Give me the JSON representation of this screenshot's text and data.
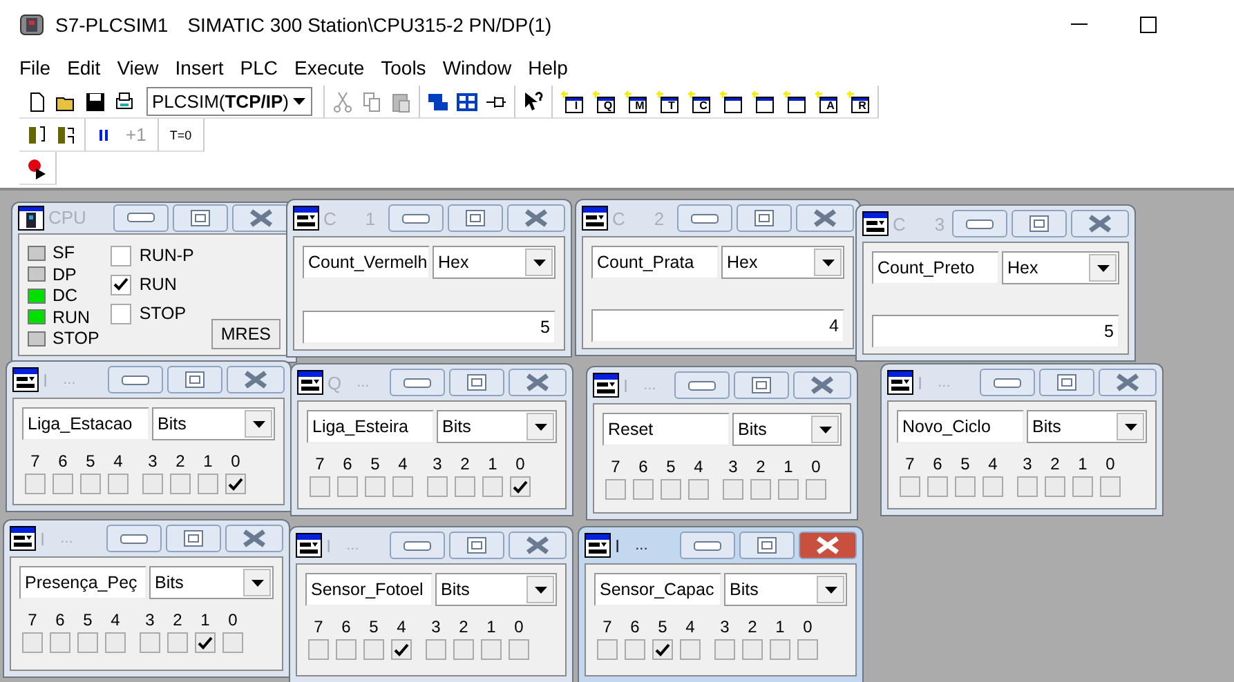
{
  "window": {
    "app": "S7-PLCSIM1",
    "title": "SIMATIC 300 Station\\CPU315-2 PN/DP(1)"
  },
  "menu": [
    "File",
    "Edit",
    "View",
    "Insert",
    "PLC",
    "Execute",
    "Tools",
    "Window",
    "Help"
  ],
  "toolbar": {
    "connection": "PLCSIM(**TCP/IP**)",
    "insert_buttons": [
      {
        "kind": "letter",
        "glyph": "I"
      },
      {
        "kind": "letter",
        "glyph": "Q"
      },
      {
        "kind": "letter",
        "glyph": "M"
      },
      {
        "kind": "letter",
        "glyph": "T"
      },
      {
        "kind": "letter",
        "glyph": "C"
      },
      {
        "kind": "plain"
      },
      {
        "kind": "plain"
      },
      {
        "kind": "plain"
      },
      {
        "kind": "letter",
        "glyph": "A"
      },
      {
        "kind": "letter",
        "glyph": "R"
      }
    ],
    "step": "+1",
    "reset_timers": "T=0"
  },
  "windows": [
    {
      "kind": "cpu",
      "title": "CPU",
      "active": false,
      "leds": [
        {
          "label": "SF",
          "on": false
        },
        {
          "label": "DP",
          "on": false
        },
        {
          "label": "DC",
          "on": true
        },
        {
          "label": "RUN",
          "on": true
        },
        {
          "label": "STOP",
          "on": false
        }
      ],
      "modes": [
        {
          "label": "RUN-P",
          "checked": false
        },
        {
          "label": "RUN",
          "checked": true
        },
        {
          "label": "STOP",
          "checked": false
        }
      ],
      "button": "MRES"
    },
    {
      "kind": "counter",
      "title": "C",
      "address": "1",
      "active": false,
      "symbol": "Count_Vermelh",
      "format": "Hex",
      "value": "5"
    },
    {
      "kind": "counter",
      "title": "C",
      "address": "2",
      "active": false,
      "symbol": "Count_Prata",
      "format": "Hex",
      "value": "4"
    },
    {
      "kind": "counter",
      "title": "C",
      "address": "3",
      "active": false,
      "symbol": "Count_Preto",
      "format": "Hex",
      "value": "5"
    },
    {
      "kind": "bits",
      "title": "I",
      "address": "...",
      "active": false,
      "symbol": "Liga_Estacao",
      "format": "Bits",
      "bits": [
        {
          "label": "7",
          "checked": false
        },
        {
          "label": "6",
          "checked": false
        },
        {
          "label": "5",
          "checked": false
        },
        {
          "label": "4",
          "checked": false
        },
        {
          "label": "3",
          "checked": false
        },
        {
          "label": "2",
          "checked": false
        },
        {
          "label": "1",
          "checked": false
        },
        {
          "label": "0",
          "checked": true
        }
      ]
    },
    {
      "kind": "bits",
      "title": "Q",
      "address": "...",
      "active": false,
      "symbol": "Liga_Esteira",
      "format": "Bits",
      "bits": [
        {
          "label": "7",
          "checked": false
        },
        {
          "label": "6",
          "checked": false
        },
        {
          "label": "5",
          "checked": false
        },
        {
          "label": "4",
          "checked": false
        },
        {
          "label": "3",
          "checked": false
        },
        {
          "label": "2",
          "checked": false
        },
        {
          "label": "1",
          "checked": false
        },
        {
          "label": "0",
          "checked": true
        }
      ]
    },
    {
      "kind": "bits",
      "title": "I",
      "address": "...",
      "active": false,
      "symbol": "Reset",
      "format": "Bits",
      "bits": [
        {
          "label": "7",
          "checked": false
        },
        {
          "label": "6",
          "checked": false
        },
        {
          "label": "5",
          "checked": false
        },
        {
          "label": "4",
          "checked": false
        },
        {
          "label": "3",
          "checked": false
        },
        {
          "label": "2",
          "checked": false
        },
        {
          "label": "1",
          "checked": false
        },
        {
          "label": "0",
          "checked": false
        }
      ]
    },
    {
      "kind": "bits",
      "title": "I",
      "address": "...",
      "active": false,
      "symbol": "Novo_Ciclo",
      "format": "Bits",
      "bits": [
        {
          "label": "7",
          "checked": false
        },
        {
          "label": "6",
          "checked": false
        },
        {
          "label": "5",
          "checked": false
        },
        {
          "label": "4",
          "checked": false
        },
        {
          "label": "3",
          "checked": false
        },
        {
          "label": "2",
          "checked": false
        },
        {
          "label": "1",
          "checked": false
        },
        {
          "label": "0",
          "checked": false
        }
      ]
    },
    {
      "kind": "bits",
      "title": "I",
      "address": "...",
      "active": false,
      "symbol": "Presença_Peç",
      "format": "Bits",
      "bits": [
        {
          "label": "7",
          "checked": false
        },
        {
          "label": "6",
          "checked": false
        },
        {
          "label": "5",
          "checked": false
        },
        {
          "label": "4",
          "checked": false
        },
        {
          "label": "3",
          "checked": false
        },
        {
          "label": "2",
          "checked": false
        },
        {
          "label": "1",
          "checked": true
        },
        {
          "label": "0",
          "checked": false
        }
      ]
    },
    {
      "kind": "bits",
      "title": "I",
      "address": "...",
      "active": false,
      "symbol": "Sensor_Fotoel",
      "format": "Bits",
      "bits": [
        {
          "label": "7",
          "checked": false
        },
        {
          "label": "6",
          "checked": false
        },
        {
          "label": "5",
          "checked": false
        },
        {
          "label": "4",
          "checked": true
        },
        {
          "label": "3",
          "checked": false
        },
        {
          "label": "2",
          "checked": false
        },
        {
          "label": "1",
          "checked": false
        },
        {
          "label": "0",
          "checked": false
        }
      ]
    },
    {
      "kind": "bits",
      "title": "I",
      "address": "...",
      "active": true,
      "symbol": "Sensor_Capac",
      "format": "Bits",
      "bits": [
        {
          "label": "7",
          "checked": false
        },
        {
          "label": "6",
          "checked": false
        },
        {
          "label": "5",
          "checked": true
        },
        {
          "label": "4",
          "checked": false
        },
        {
          "label": "3",
          "checked": false
        },
        {
          "label": "2",
          "checked": false
        },
        {
          "label": "1",
          "checked": false
        },
        {
          "label": "0",
          "checked": false
        }
      ]
    }
  ]
}
